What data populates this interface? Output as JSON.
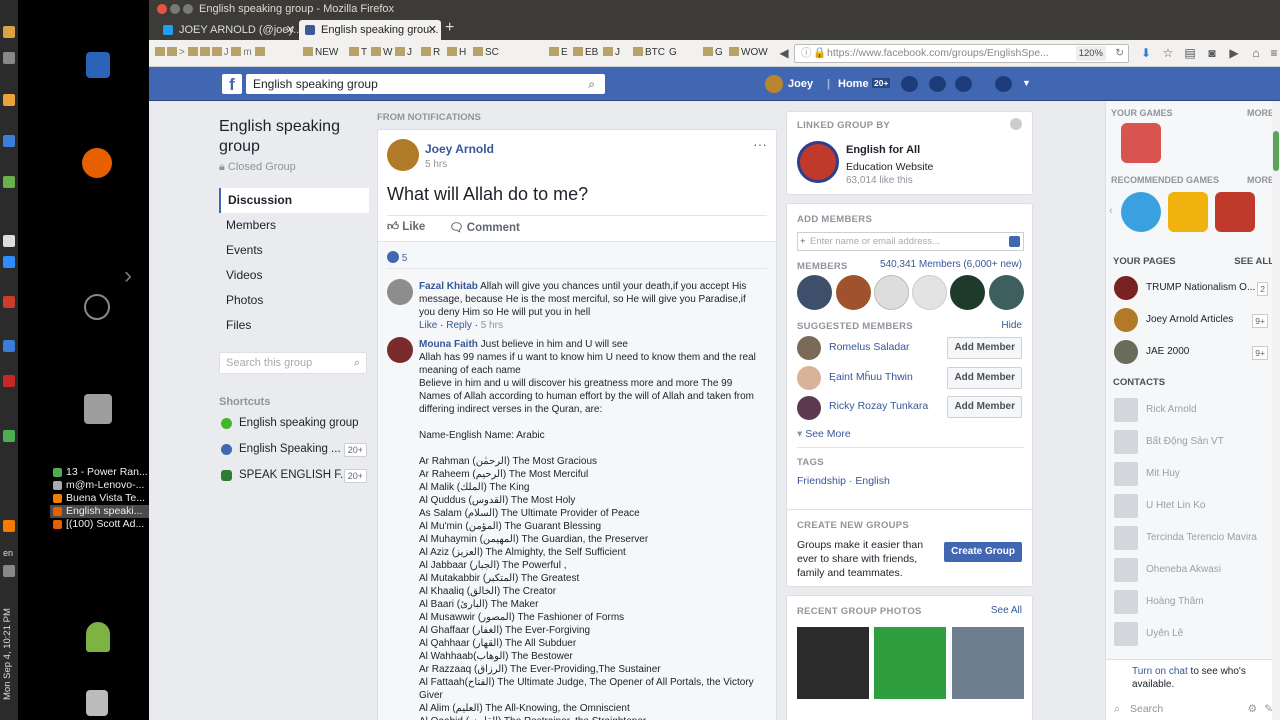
{
  "os": {
    "clock": "Mon Sep 4, 10:21 PM",
    "lang": "en",
    "window_list": [
      "13 - Power Ran...",
      "m@m-Lenovo-...",
      "Buena Vista Te...",
      "English speaki...",
      "[(100) Scott Ad..."
    ]
  },
  "browser": {
    "title": "English speaking group - Mozilla Firefox",
    "tabs": [
      {
        "label": "JOEY ARNOLD (@joey..."
      },
      {
        "label": "English speaking grou..."
      }
    ],
    "bookmarks": [
      "NEW",
      "T",
      "W",
      "J",
      "R",
      "H",
      "SC",
      "E",
      "EB",
      "J",
      "BTC",
      "G",
      "G",
      "WOW"
    ],
    "url": "https://www.facebook.com/groups/EnglishSpe...",
    "zoom": "120%"
  },
  "fb": {
    "search_value": "English speaking group",
    "user": "Joey",
    "home": "Home",
    "home_count": "20+"
  },
  "left": {
    "group_name": "English speaking group",
    "privacy": "Closed Group",
    "nav": [
      "Discussion",
      "Members",
      "Events",
      "Videos",
      "Photos",
      "Files"
    ],
    "search_placeholder": "Search this group",
    "shortcuts_title": "Shortcuts",
    "shortcuts": [
      {
        "label": "English speaking group",
        "count": ""
      },
      {
        "label": "English Speaking ...",
        "count": "20+"
      },
      {
        "label": "SPEAK ENGLISH F...",
        "count": "20+"
      }
    ]
  },
  "post": {
    "from": "FROM NOTIFICATIONS",
    "author": "Joey Arnold",
    "time": "5 hrs",
    "text": "What will Allah do to me?",
    "like": "Like",
    "comment": "Comment",
    "reactions": "5",
    "c1": {
      "author": "Fazal Khitab",
      "text": "Allah will give you chances until your death,if you accept His message, because He is the most merciful, so He will give you Paradise,if you deny Him so He will put you in hell",
      "like": "Like",
      "reply": "Reply",
      "time": "5 hrs"
    },
    "c2": {
      "author": "Mouna Faith",
      "first": "Just believe in him and U will see",
      "lines": [
        "Allah has 99 names if u want to know him U need to know them and the real meaning of each name",
        "Believe in him and u will discover his greatness more and more The 99 Names of Allah according to human effort by the will of Allah and taken from differing indirect verses in the Quran, are:",
        "",
        "Name-English Name: Arabic",
        "",
        "Ar Rahman (الرحمٰن) The Most Gracious",
        "Ar Raheem (الرحيم) The Most Merciful",
        "Al Malik (الملك) The King",
        "Al Quddus (القدوس) The Most Holy",
        "As Salam (السلام) The Ultimate Provider of Peace",
        "Al Mu'min (المؤمن) The Guarant Blessing",
        "Al Muhaymin (المهيمن) The Guardian, the Preserver",
        "Al Aziz (العزيز) The Almighty, the Self Sufficient",
        "Al Jabbaar (الجبار) The Powerful ,",
        "Al Mutakabbir (المتكبر) The Greatest",
        "Al Khaaliq (الخالق) The Creator",
        "Al Baari (البارئ) The Maker",
        "Al Musawwir (المصور) The Fashioner of Forms",
        "Al Ghaffaar (الغفار) The Ever-Forgiving",
        "Al Qahhaar (القهار) The All Subduer",
        "Al Wahhaab(الوهاب) The Bestower",
        "Ar Razzaaq (الرزاق) The Ever-Providing,The Sustainer",
        "Al Fattaah(الفتاح) The Ultimate Judge, The Opener of All Portals, the Victory Giver",
        "Al Alim (العليم) The All-Knowing, the Omniscient",
        "Al Qaabid (القابض) The Restrainer, the Straightener"
      ]
    }
  },
  "right": {
    "linked_title": "LINKED GROUP BY",
    "linked_name": "English for All",
    "linked_type": "Education Website",
    "linked_likes": "63,014 like this",
    "add_title": "ADD MEMBERS",
    "add_placeholder": "Enter name or email address...",
    "members_title": "MEMBERS",
    "members_count": "540,341 Members (6,000+ new)",
    "suggested_title": "SUGGESTED MEMBERS",
    "hide": "Hide",
    "suggested": [
      {
        "name": "Romelus Saladar",
        "btn": "Add Member"
      },
      {
        "name": "Ęaint Mĥuu Thwin",
        "btn": "Add Member"
      },
      {
        "name": "Ricky Rozay Tunkara",
        "btn": "Add Member"
      }
    ],
    "see_more": "See More",
    "tags_title": "TAGS",
    "tags": "Friendship · English",
    "create_title": "CREATE NEW GROUPS",
    "create_text": "Groups make it easier than ever to share with friends, family and teammates.",
    "create_btn": "Create Group",
    "photos_title": "RECENT GROUP PHOTOS",
    "see_all": "See All"
  },
  "rail": {
    "games": "YOUR GAMES",
    "more": "MORE",
    "rec": "RECOMMENDED GAMES",
    "more2": "MORE",
    "pages": "YOUR PAGES",
    "see_all": "SEE ALL",
    "page_list": [
      {
        "name": "TRUMP Nationalism O...",
        "count": "2"
      },
      {
        "name": "Joey Arnold Articles",
        "count": "9+"
      },
      {
        "name": "JAE 2000",
        "count": "9+"
      }
    ],
    "contacts": "CONTACTS",
    "contact_list": [
      "Rick Arnold",
      "Bất Động Sản VT",
      "Mit Huy",
      "U Htet Lin Ko",
      "Tercinda Terencio Mavira",
      "Oheneba Akwasi",
      "Hoàng Thâm",
      "Uyên Lê"
    ],
    "chat_link": "Turn on chat",
    "chat_rest": " to see who's available.",
    "search": "Search"
  }
}
